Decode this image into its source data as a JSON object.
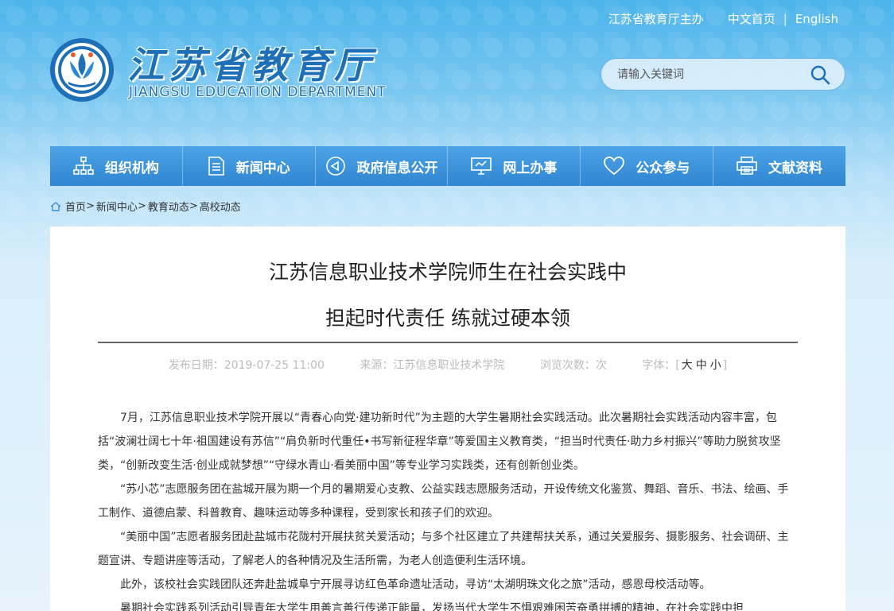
{
  "header": {
    "host": "江苏省教育厅主办",
    "home_cn": "中文首页",
    "separator": "|",
    "english": "English",
    "title_cn": "江苏省教育厅",
    "title_en": "JIANGSU EDUCATION DEPARTMENT",
    "search_placeholder": "请输入关键词"
  },
  "nav": [
    {
      "label": "组织机构",
      "icon": "org-chart-icon"
    },
    {
      "label": "新闻中心",
      "icon": "document-icon"
    },
    {
      "label": "政府信息公开",
      "icon": "speaker-icon"
    },
    {
      "label": "网上办事",
      "icon": "monitor-icon"
    },
    {
      "label": "公众参与",
      "icon": "heart-icon"
    },
    {
      "label": "文献资料",
      "icon": "printer-icon"
    }
  ],
  "breadcrumb": {
    "home": "首页",
    "news": "新闻中心",
    "edu": "教育动态",
    "college": "高校动态",
    "arrow": ">"
  },
  "article": {
    "title_line1": "江苏信息职业技术学院师生在社会实践中",
    "title_line2": "担起时代责任 练就过硬本领",
    "publish_date": "发布日期：2019-07-25 11:00",
    "source": "来源：江苏信息职业技术学院",
    "views": "浏览次数：次",
    "font_label": "字体：[",
    "font_large": "大",
    "font_medium": "中",
    "font_small": "小",
    "font_close": "]",
    "paragraphs": [
      "7月，江苏信息职业技术学院开展以“青春心向党·建功新时代”为主题的大学生暑期社会实践活动。此次暑期社会实践活动内容丰富，包括“波澜壮阔七十年·祖国建设有苏信”“肩负新时代重任•书写新征程华章”等爱国主义教育类，“担当时代责任·助力乡村振兴”等助力脱贫攻坚类，“创新改变生活·创业成就梦想”“守绿水青山·看美丽中国”等专业学习实践类，还有创新创业类。",
      "“苏小芯”志愿服务团在盐城开展为期一个月的暑期爱心支教、公益实践志愿服务活动，开设传统文化鉴赏、舞蹈、音乐、书法、绘画、手工制作、道德启蒙、科普教育、趣味运动等多种课程，受到家长和孩子们的欢迎。",
      "“美丽中国”志愿者服务团赴盐城市花陇村开展扶贫关爱活动；与多个社区建立了共建帮扶关系，通过关爱服务、摄影服务、社会调研、主题宣讲、专题讲座等活动，了解老人的各种情况及生活所需，为老人创造便利生活环境。",
      "此外，该校社会实践团队还奔赴盐城阜宁开展寻访红色革命遗址活动，寻访“太湖明珠文化之旅”活动，感恩母校活动等。",
      "暑期社会实践系列活动引导青年大学生用善言善行传递正能量，发扬当代大学生不惧艰难困苦奋勇拼搏的精神，在社会实践中担"
    ]
  }
}
